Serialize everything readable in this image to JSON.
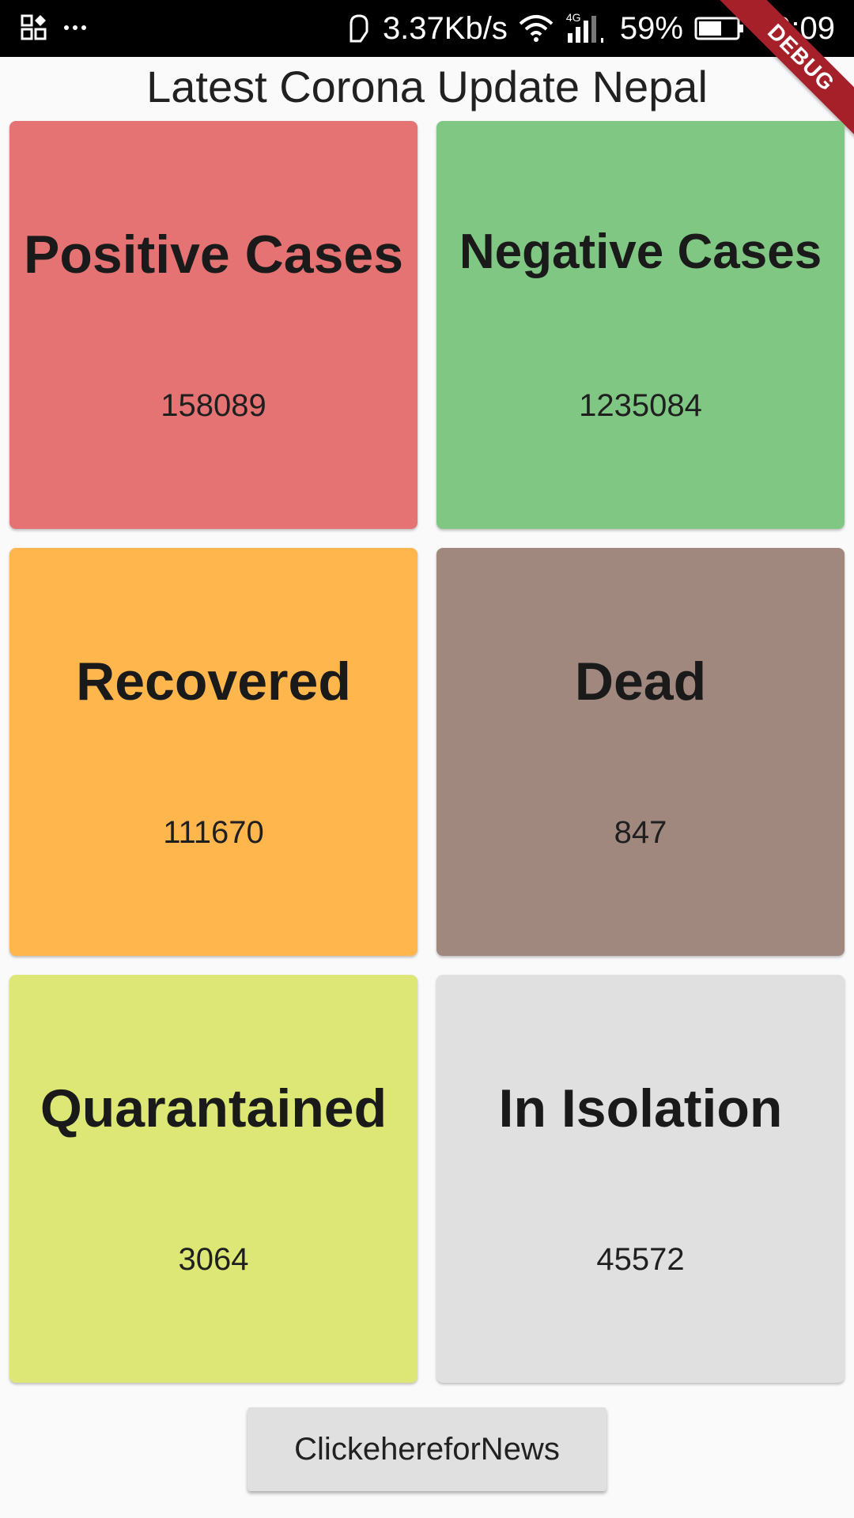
{
  "status_bar": {
    "network_speed": "3.37Kb/s",
    "network_type": "4G",
    "battery": "59%",
    "time": "19:09"
  },
  "debug_banner": "DEBUG",
  "page": {
    "title": "Latest Corona Update Nepal"
  },
  "cards": [
    {
      "label": "Positive Cases",
      "value": "158089",
      "color": "#e57373"
    },
    {
      "label": "Negative Cases",
      "value": "1235084",
      "color": "#81c784"
    },
    {
      "label": "Recovered",
      "value": "111670",
      "color": "#ffb74d"
    },
    {
      "label": "Dead",
      "value": "847",
      "color": "#a1887f"
    },
    {
      "label": "Quarantained",
      "value": "3064",
      "color": "#dce775"
    },
    {
      "label": "In Isolation",
      "value": "45572",
      "color": "#e0e0e0"
    }
  ],
  "news_button": {
    "label": "ClickehereforNews"
  }
}
